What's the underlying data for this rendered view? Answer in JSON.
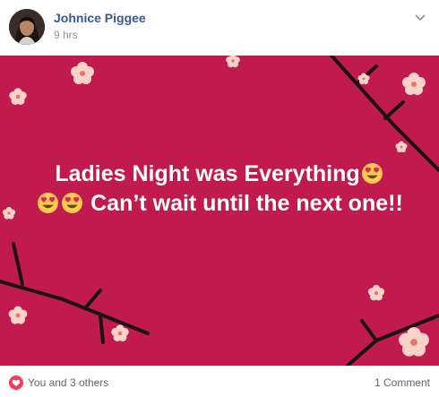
{
  "post": {
    "author": "Johnice Piggee",
    "time": "9 hrs",
    "message": {
      "line1": "Ladies Night was Everything",
      "line2": "Can’t wait until the next one!!"
    },
    "emoji_icon": "heart-eyes-emoji"
  },
  "reactions": {
    "icon": "heart-reaction-icon",
    "summary": "You and 3 others"
  },
  "comments": {
    "count_label": "1 Comment"
  },
  "colors": {
    "background": "#c01a4f",
    "author_link": "#385898",
    "meta_text": "#90949c",
    "heart": "#f33e58"
  }
}
